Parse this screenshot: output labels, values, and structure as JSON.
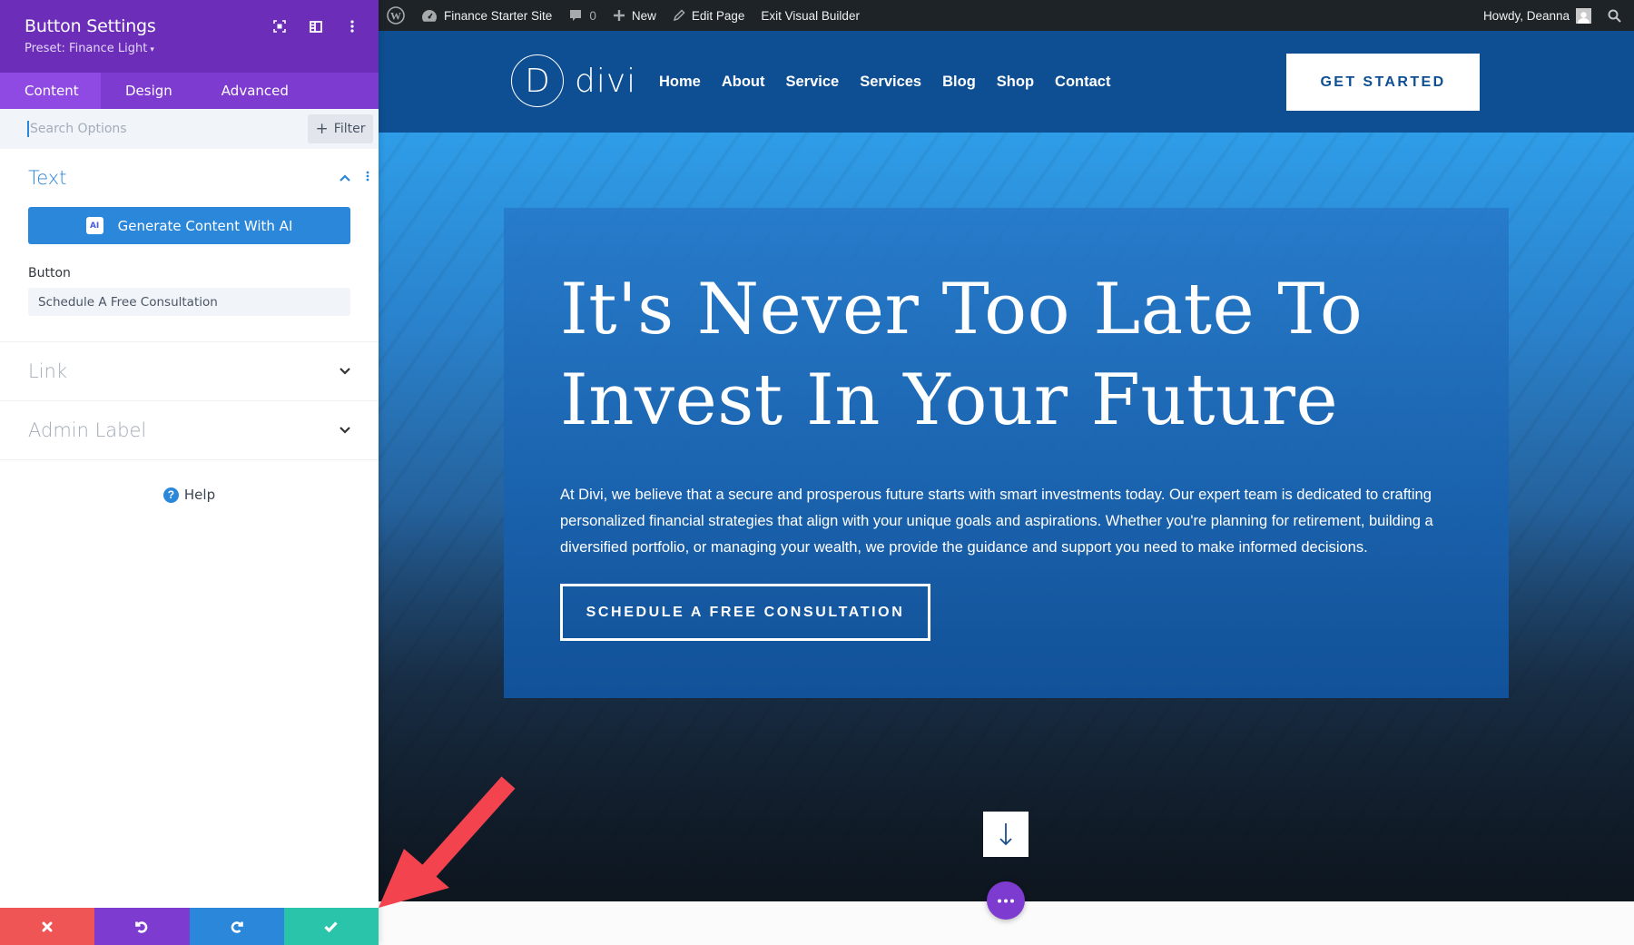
{
  "sidebar": {
    "title": "Button Settings",
    "preset": "Preset: Finance Light",
    "header_icons": [
      "focus-icon",
      "split-view-icon",
      "more-vertical-icon"
    ],
    "tabs": [
      {
        "label": "Content",
        "active": true
      },
      {
        "label": "Design",
        "active": false
      },
      {
        "label": "Advanced",
        "active": false
      }
    ],
    "search": {
      "placeholder": "Search Options",
      "value": ""
    },
    "filter_label": "Filter",
    "sections": {
      "text": {
        "title": "Text",
        "expanded": true,
        "ai_button_label": "Generate Content With AI",
        "ai_badge": "AI",
        "button_field_label": "Button",
        "button_field_value": "Schedule A Free Consultation"
      },
      "link": {
        "title": "Link",
        "expanded": false
      },
      "admin_label": {
        "title": "Admin Label",
        "expanded": false
      }
    },
    "help_label": "Help",
    "actions": {
      "cancel": "cancel",
      "undo": "undo",
      "redo": "redo",
      "save": "save"
    },
    "colors": {
      "header": "#6c2eb9",
      "tabs": "#7d3bcf",
      "accent": "#2b87da",
      "cancel": "#ef5555",
      "undo": "#7e3bd0",
      "redo": "#2b87da",
      "save": "#29c4a9"
    }
  },
  "adminbar": {
    "site_name": "Finance Starter Site",
    "comments_count": "0",
    "new_label": "New",
    "edit_label": "Edit Page",
    "exit_label": "Exit Visual Builder",
    "greeting": "Howdy, Deanna"
  },
  "site": {
    "logo_letter": "D",
    "logo_word": "divi",
    "nav": [
      "Home",
      "About",
      "Service",
      "Services",
      "Blog",
      "Shop",
      "Contact"
    ],
    "header_cta": "GET STARTED",
    "hero": {
      "title_line1": "It's Never Too Late To",
      "title_line2": "Invest In Your Future",
      "description": "At Divi, we believe that a secure and prosperous future starts with smart investments today. Our expert team is dedicated to crafting personalized financial strategies that align with your unique goals and aspirations. Whether you're planning for retirement, building a diversified portfolio, or managing your wealth, we provide the guidance and support you need to make informed decisions.",
      "cta": "SCHEDULE A FREE CONSULTATION"
    },
    "colors": {
      "header_bg": "#0e4f93",
      "hero_top": "#2f9de8"
    }
  },
  "annotation": {
    "type": "arrow",
    "color": "#f2434f",
    "points_to": "save-button"
  }
}
